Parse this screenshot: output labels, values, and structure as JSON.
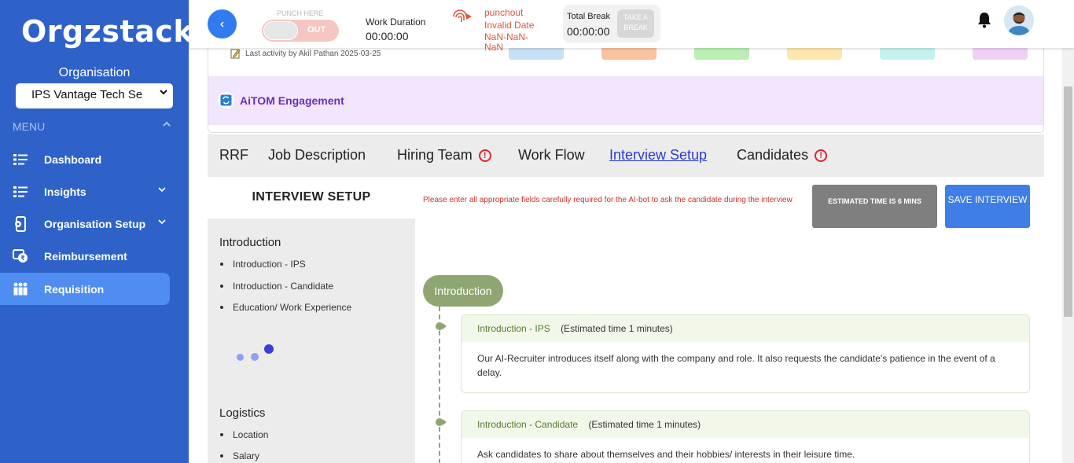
{
  "sidebar": {
    "logo": "Orgzstack",
    "org_label": "Organisation",
    "org_selected": "IPS Vantage Tech Se",
    "menu_label": "MENU",
    "items": [
      {
        "label": "Dashboard",
        "icon": "dashboard-icon",
        "has_caret": false,
        "active": false
      },
      {
        "label": "Insights",
        "icon": "insights-icon",
        "has_caret": true,
        "active": false
      },
      {
        "label": "Organisation Setup",
        "icon": "organisation-setup-icon",
        "has_caret": true,
        "active": false
      },
      {
        "label": "Reimbursement",
        "icon": "reimbursement-icon",
        "has_caret": false,
        "active": false
      },
      {
        "label": "Requisition",
        "icon": "requisition-icon",
        "has_caret": false,
        "active": true
      }
    ]
  },
  "topbar": {
    "punch_label": "PUNCH HERE",
    "punch_state": "OUT",
    "work_duration_label": "Work Duration",
    "work_duration_value": "00:00:00",
    "punchout_label": "punchout",
    "punchout_date": "Invalid Date",
    "punchout_nan": "NaN-NaN-NaN",
    "total_break_label": "Total Break",
    "total_break_value": "00:00:00",
    "take_break_label": "TAKE A BREAK"
  },
  "summary": {
    "last_activity": "Last activity by Akil Pathan 2025-03-25",
    "chip_colors": [
      "#c7e1f5",
      "#f8c39f",
      "#b9f0b2",
      "#fde7ad",
      "#c3f2ee",
      "#f1d0f4"
    ],
    "engagement_title": "AiTOM Engagement"
  },
  "tabs": [
    {
      "label": "RRF",
      "active": false,
      "alert": false
    },
    {
      "label": "Job Description",
      "active": false,
      "alert": false
    },
    {
      "label": "Hiring Team",
      "active": false,
      "alert": true
    },
    {
      "label": "Work Flow",
      "active": false,
      "alert": false
    },
    {
      "label": "Interview Setup",
      "active": true,
      "alert": false
    },
    {
      "label": "Candidates",
      "active": false,
      "alert": true
    }
  ],
  "interview_setup": {
    "title": "INTERVIEW SETUP",
    "sections": [
      {
        "title": "Introduction",
        "items": [
          "Introduction - IPS",
          "Introduction - Candidate",
          "Education/ Work Experience"
        ]
      },
      {
        "title": "Logistics",
        "items": [
          "Location",
          "Salary"
        ]
      }
    ],
    "note": "Please enter all appropriate fields carefully required for the AI-bot to ask the candidate during the interview",
    "estimated_time_label": "ESTIMATED TIME IS 6 MINS",
    "save_label": "SAVE INTERVIEW",
    "flow_stage": "Introduction",
    "questions": [
      {
        "title": "Introduction - IPS",
        "time": "(Estimated time 1 minutes)",
        "body": "Our AI-Recruiter introduces itself along with the company and role. It also requests the candidate's patience in the event of a delay."
      },
      {
        "title": "Introduction - Candidate",
        "time": "(Estimated time 1 minutes)",
        "body": "Ask candidates to share about themselves and their hobbies/ interests in their leisure time."
      }
    ]
  },
  "colors": {
    "sidebar_bg": "#2e62c9",
    "active_nav": "#4f8df0",
    "accent_green": "#8fa673",
    "error_red": "#c9332b",
    "save_blue": "#3e7ee6"
  }
}
